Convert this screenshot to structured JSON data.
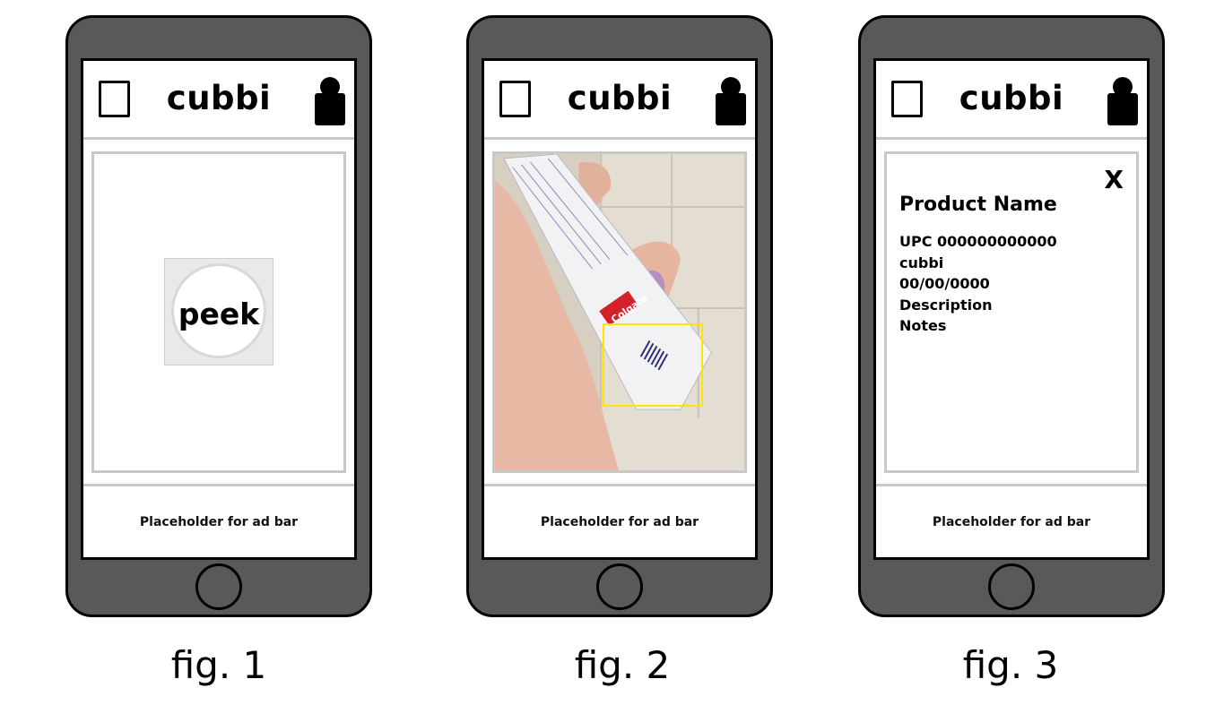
{
  "figures": [
    {
      "caption": "fig. 1",
      "app_title": "cubbi",
      "ad_bar": "Placeholder for ad bar",
      "peek_button_label": "peek"
    },
    {
      "caption": "fig. 2",
      "app_title": "cubbi",
      "ad_bar": "Placeholder for ad bar",
      "camera": {
        "package_brand": "Colgate",
        "scan_box_color": "#ffe600"
      }
    },
    {
      "caption": "fig. 3",
      "app_title": "cubbi",
      "ad_bar": "Placeholder for ad bar",
      "close_label": "X",
      "product": {
        "name": "Product Name",
        "upc": "UPC 000000000000",
        "brand": "cubbi",
        "date": "00/00/0000",
        "description": "Description",
        "notes": "Notes"
      }
    }
  ],
  "icons": {
    "menu": "square-menu-icon",
    "user": "user-profile-icon",
    "home": "home-button-icon"
  },
  "colors": {
    "phone_body": "#595959",
    "divider": "#c8c8c8",
    "scan_box": "#ffe600"
  }
}
